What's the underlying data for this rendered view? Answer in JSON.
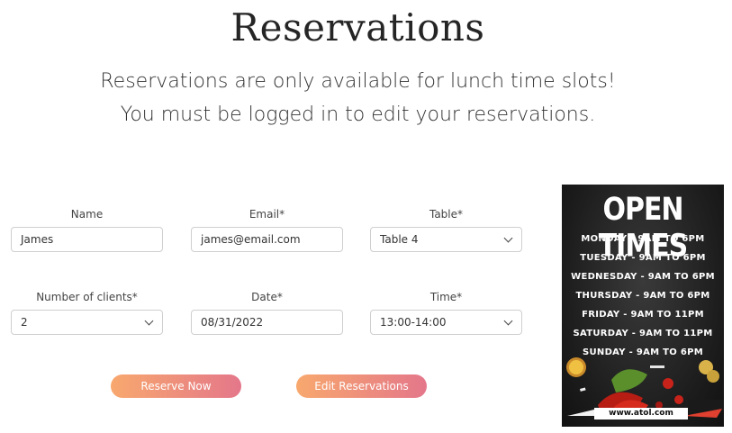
{
  "page": {
    "title": "Reservations",
    "subtitle_line1": "Reservations are only available for lunch time slots!",
    "subtitle_line2": "You must be logged in to edit your reservations."
  },
  "form": {
    "name": {
      "label": "Name",
      "value": "James"
    },
    "email": {
      "label": "Email*",
      "value": "james@email.com"
    },
    "table": {
      "label": "Table*",
      "value": "Table 4"
    },
    "clients": {
      "label": "Number of clients*",
      "value": "2"
    },
    "date": {
      "label": "Date*",
      "value": "08/31/2022"
    },
    "time": {
      "label": "Time*",
      "value": "13:00-14:00"
    }
  },
  "buttons": {
    "reserve": "Reserve Now",
    "edit": "Edit Reservations"
  },
  "poster": {
    "title": "OPEN TIMES",
    "hours": [
      "MONDAY - 9AM TO 6PM",
      "TUESDAY - 9AM TO 6PM",
      "WEDNESDAY - 9AM TO 6PM",
      "THURSDAY - 9AM TO 6PM",
      "FRIDAY - 9AM TO 11PM",
      "SATURDAY - 9AM TO 11PM",
      "SUNDAY - 9AM TO 6PM"
    ],
    "url": "www.atol.com"
  },
  "colors": {
    "button_gradient_start": "#f8a86e",
    "button_gradient_end": "#e4778a"
  }
}
